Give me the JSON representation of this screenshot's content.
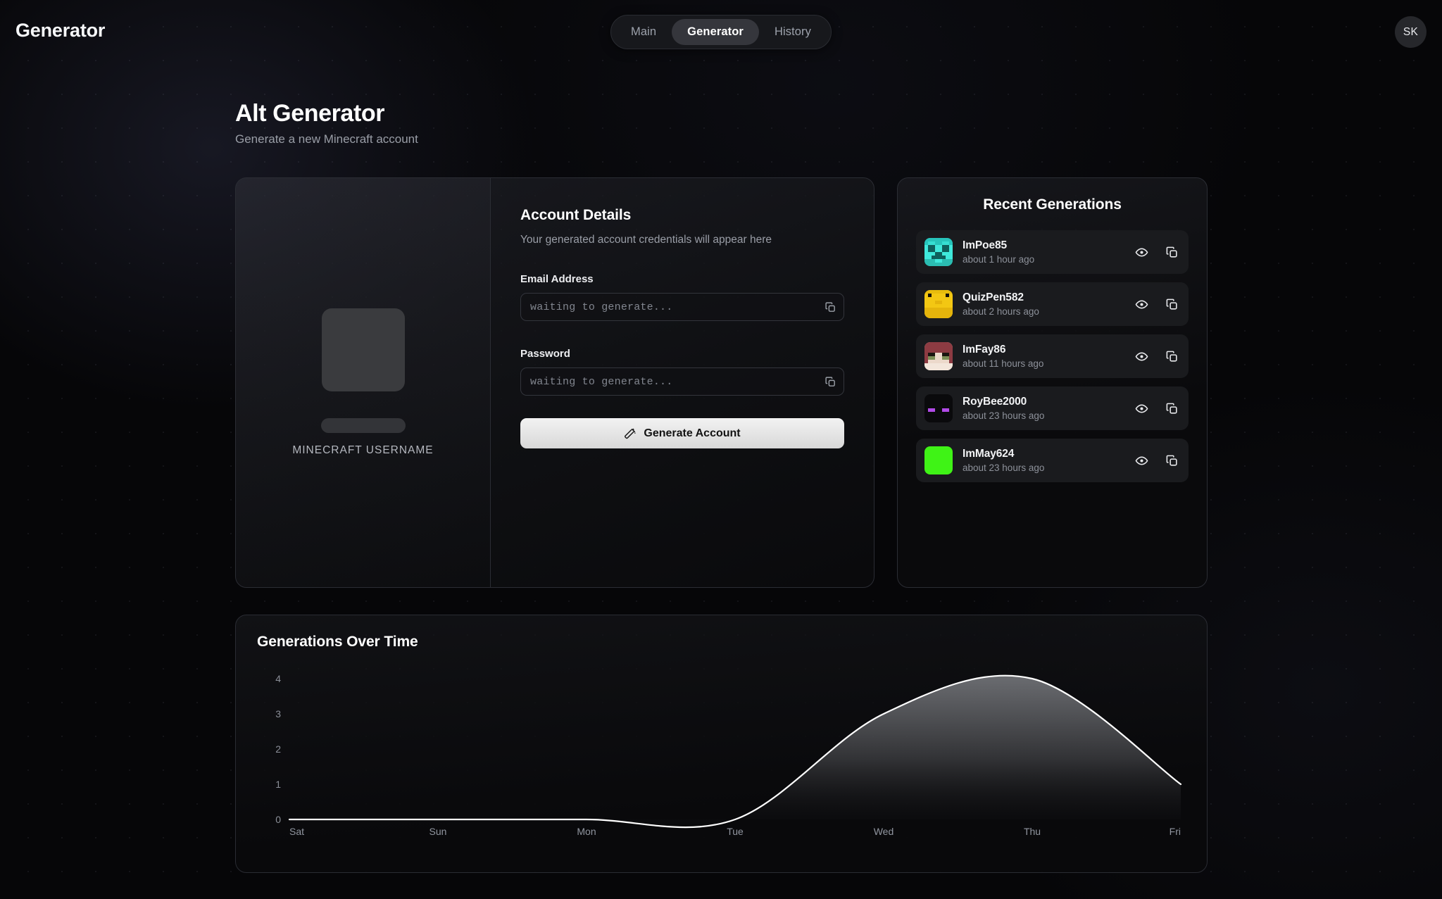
{
  "topbar": {
    "brand": "Generator",
    "tabs": [
      {
        "label": "Main",
        "active": false
      },
      {
        "label": "Generator",
        "active": true
      },
      {
        "label": "History",
        "active": false
      }
    ],
    "avatar_initials": "SK"
  },
  "page": {
    "title": "Alt Generator",
    "subtitle": "Generate a new Minecraft account"
  },
  "preview": {
    "caption": "MINECRAFT USERNAME"
  },
  "account_details": {
    "title": "Account Details",
    "subtitle": "Your generated account credentials will appear here",
    "email_label": "Email Address",
    "email_value": "waiting to generate...",
    "password_label": "Password",
    "password_value": "waiting to generate...",
    "generate_button": "Generate Account"
  },
  "recent": {
    "title": "Recent Generations",
    "items": [
      {
        "name": "ImPoe85",
        "time": "about 1 hour ago",
        "skin": "creeper-cyan"
      },
      {
        "name": "QuizPen582",
        "time": "about 2 hours ago",
        "skin": "yellow-blob"
      },
      {
        "name": "ImFay86",
        "time": "about 11 hours ago",
        "skin": "red-hair"
      },
      {
        "name": "RoyBee2000",
        "time": "about 23 hours ago",
        "skin": "enderman"
      },
      {
        "name": "ImMay624",
        "time": "about 23 hours ago",
        "skin": "lime-green"
      }
    ]
  },
  "chart_data": {
    "type": "area",
    "title": "Generations Over Time",
    "categories": [
      "Sat",
      "Sun",
      "Mon",
      "Tue",
      "Wed",
      "Thu",
      "Fri"
    ],
    "values": [
      0,
      0,
      0,
      0,
      3,
      4,
      1
    ],
    "yticks": [
      0,
      1,
      2,
      3,
      4
    ],
    "ylim": [
      0,
      4
    ],
    "xlabel": "",
    "ylabel": "",
    "grid": false,
    "legend": false,
    "line_color": "#ffffff",
    "fill_top_color": "#8f9196",
    "fill_bottom_color": "#17181b"
  },
  "colors": {
    "page_bg": "#060608",
    "card_border": "#2b2d34",
    "accent_glow": "#686ca0",
    "button_fg": "#121212",
    "muted_text": "#9a9ea7"
  }
}
